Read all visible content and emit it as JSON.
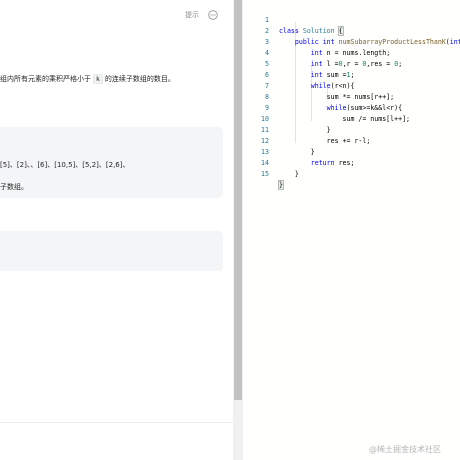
{
  "left_panel": {
    "hint_label": "提示",
    "description_before": "组内所有元素的乘积严格小于",
    "description_code": "k",
    "description_after": "的连续子数组的数目。",
    "example_line1": "[5]、[2]、、[6]、[10,5]、[5,2]、[2,6]、",
    "example_line2": "子数组。"
  },
  "editor": {
    "lines": [
      {
        "n": "1",
        "code": "class Solution {"
      },
      {
        "n": "2",
        "code": "    public int numSubarrayProductLessThanK(int"
      },
      {
        "n": "3",
        "code": "        int n = nums.length;"
      },
      {
        "n": "4",
        "code": "        int l =0,r = 0,res = 0;"
      },
      {
        "n": "5",
        "code": "        int sum =1;"
      },
      {
        "n": "6",
        "code": "        while(r<n){"
      },
      {
        "n": "7",
        "code": "            sum *= nums[r++];"
      },
      {
        "n": "8",
        "code": "            while(sum>=k&&l<r){"
      },
      {
        "n": "9",
        "code": "                sum /= nums[l++];"
      },
      {
        "n": "10",
        "code": "            }"
      },
      {
        "n": "11",
        "code": "            res += r-l;"
      },
      {
        "n": "12",
        "code": "        }"
      },
      {
        "n": "13",
        "code": "        return res;"
      },
      {
        "n": "14",
        "code": "    }"
      },
      {
        "n": "15",
        "code": "}"
      }
    ]
  },
  "watermark": "@稀土掘金技术社区",
  "colors": {
    "keyword": "#0000ff",
    "type": "#267f99",
    "function": "#795e26",
    "number": "#098658",
    "line_number": "#237893"
  }
}
